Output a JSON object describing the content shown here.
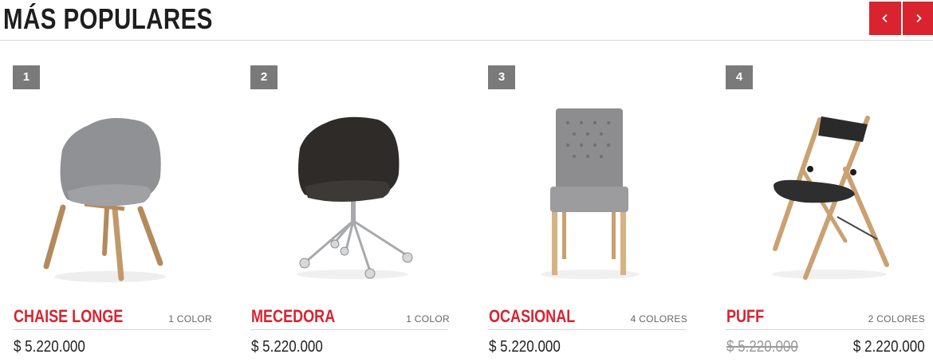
{
  "section": {
    "title": "MÁS POPULARES"
  },
  "nav": {
    "prev_icon": "chevron-left-icon",
    "next_icon": "chevron-right-icon"
  },
  "colors": {
    "accent": "#d9232e",
    "rank_badge": "#7a7a7a",
    "divider": "#d6d6d6"
  },
  "products": [
    {
      "rank": "1",
      "name": "CHAISE LONGE",
      "colors": "1 COLOR",
      "price": "$ 5.220.000"
    },
    {
      "rank": "2",
      "name": "MECEDORA",
      "colors": "1 COLOR",
      "price": "$ 5.220.000"
    },
    {
      "rank": "3",
      "name": "OCASIONAL",
      "colors": "4 COLORES",
      "price": "$ 5.220.000"
    },
    {
      "rank": "4",
      "name": "PUFF",
      "colors": "2 COLORES",
      "old_price": "$ 5.220.000",
      "price": "$ 2.220.000"
    }
  ]
}
